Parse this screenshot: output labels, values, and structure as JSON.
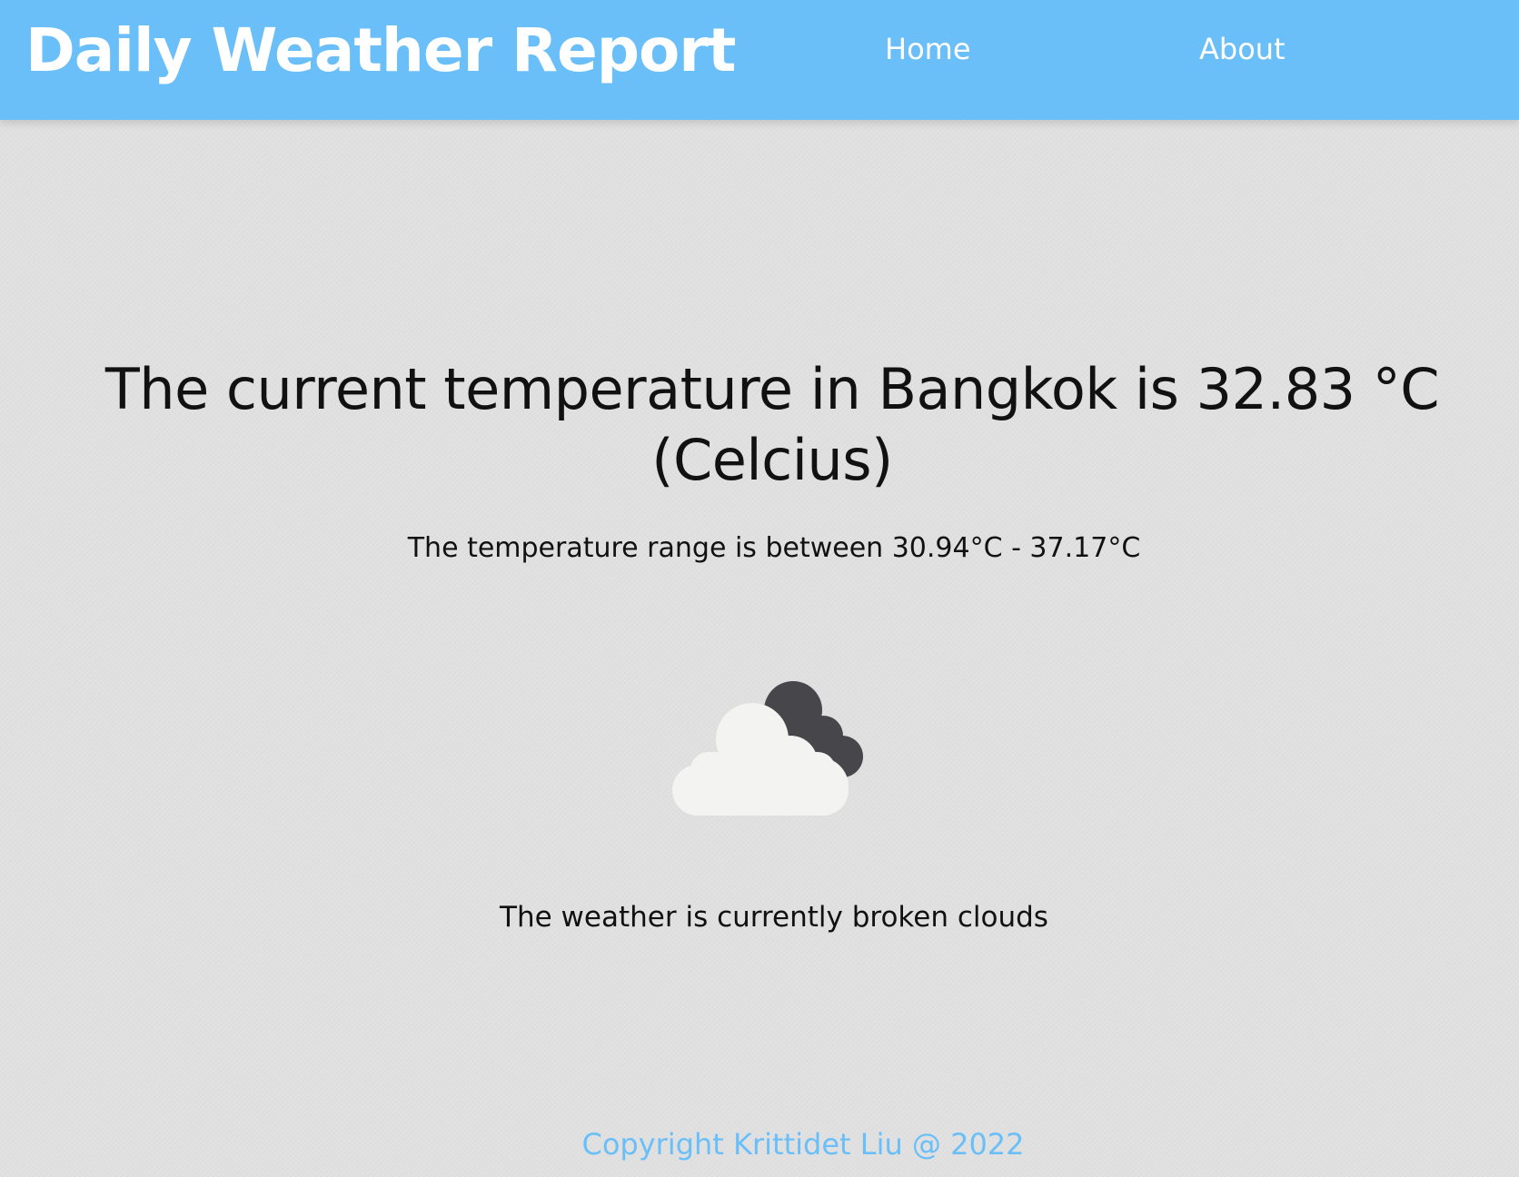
{
  "navbar": {
    "brand": "Daily Weather Report",
    "links": [
      {
        "label": "Home"
      },
      {
        "label": "About"
      }
    ],
    "background_color": "#6abff9"
  },
  "main": {
    "headline": "The current temperature in Bangkok is 32.83 °C (Celcius)",
    "range": "The temperature range is between 30.94°C - 37.17°C",
    "icon": "broken-clouds-icon",
    "description": "The weather is currently broken clouds"
  },
  "footer": {
    "copyright": "Copyright Krittidet Liu @ 2022",
    "color": "#6abff9"
  }
}
